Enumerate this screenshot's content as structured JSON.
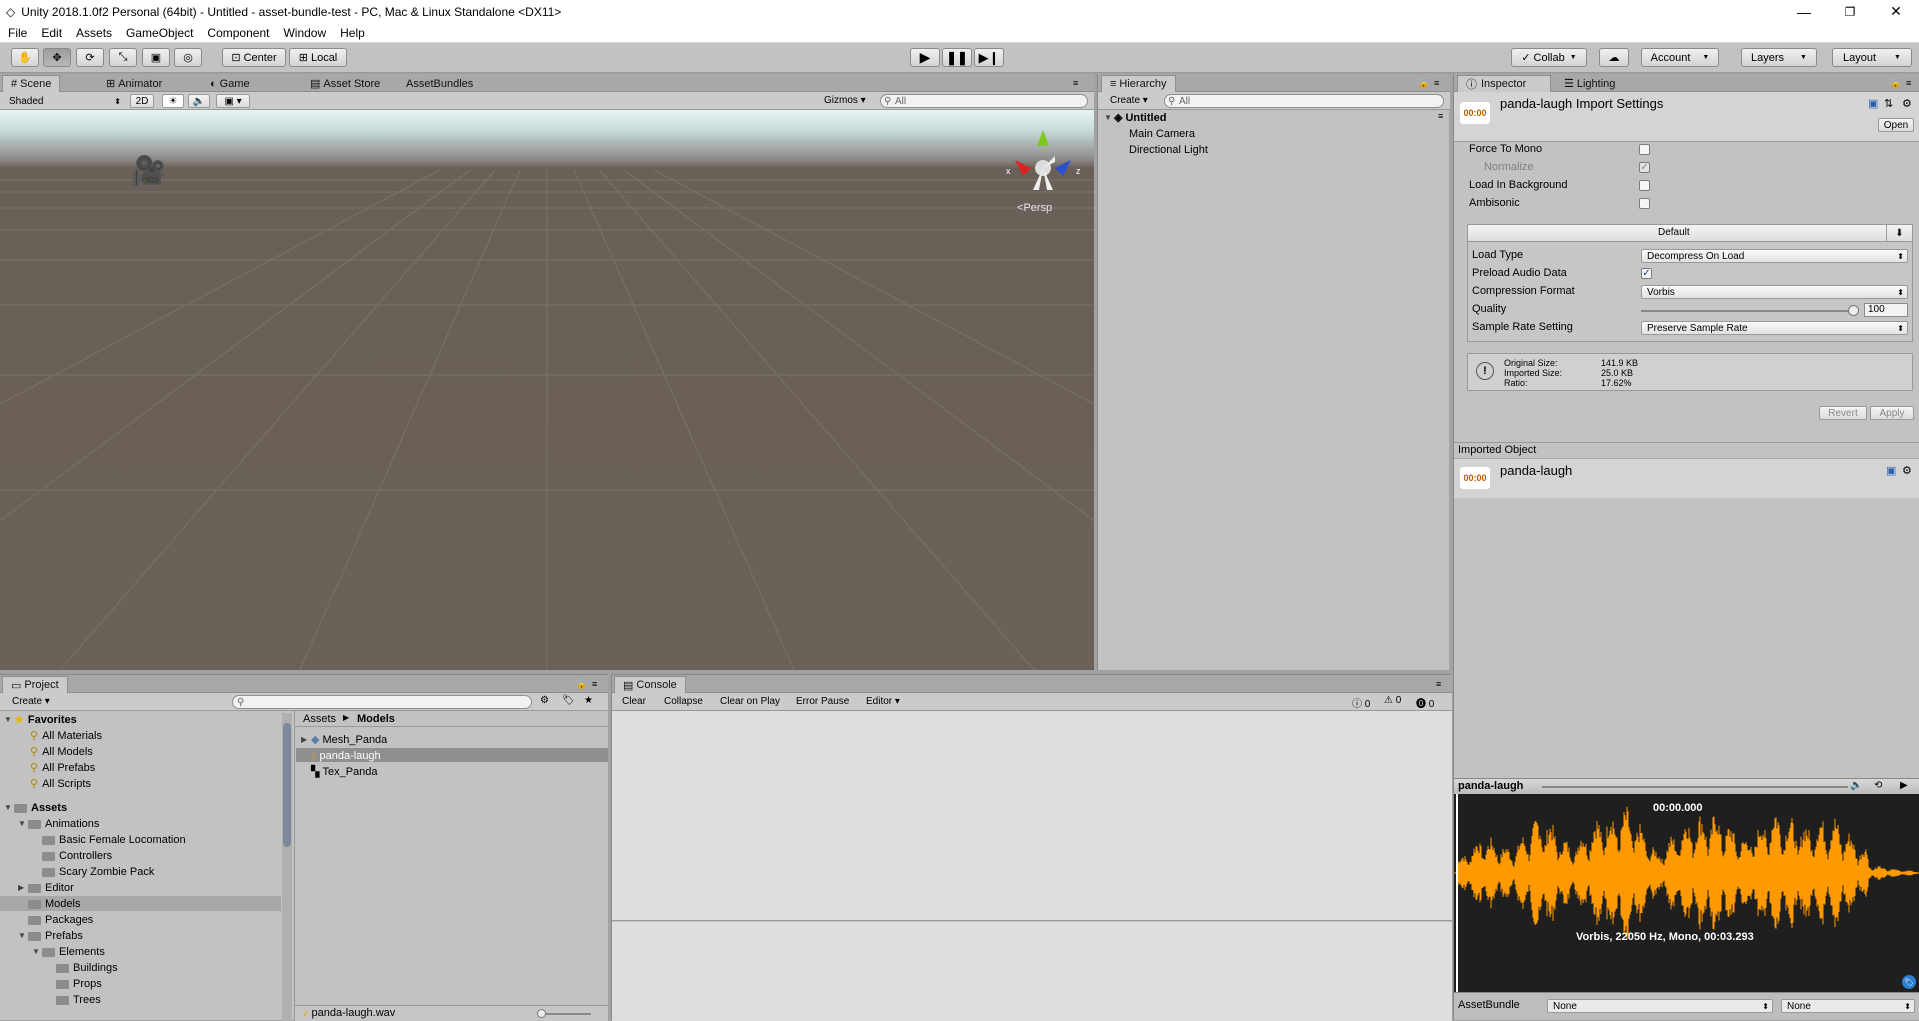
{
  "window": {
    "title": "Unity 2018.1.0f2 Personal (64bit) - Untitled - asset-bundle-test - PC, Mac & Linux Standalone <DX11>"
  },
  "menu": [
    "File",
    "Edit",
    "Assets",
    "GameObject",
    "Component",
    "Window",
    "Help"
  ],
  "toolbar": {
    "center": "Center",
    "local": "Local",
    "collab": "Collab",
    "account": "Account",
    "layers": "Layers",
    "layout": "Layout"
  },
  "scene": {
    "tabs": [
      "Scene",
      "Animator",
      "Game",
      "Asset Store",
      "AssetBundles"
    ],
    "shading": "Shaded",
    "mode2d": "2D",
    "gizmos": "Gizmos",
    "search_placeholder": "All",
    "persp": "Persp",
    "axis_x": "x",
    "axis_z": "z"
  },
  "hierarchy": {
    "tab": "Hierarchy",
    "create": "Create",
    "search_placeholder": "All",
    "scene_name": "Untitled",
    "items": [
      "Main Camera",
      "Directional Light"
    ]
  },
  "inspector": {
    "tabs": [
      "Inspector",
      "Lighting"
    ],
    "asset_title": "panda-laugh Import Settings",
    "icon_text": "00:00",
    "open": "Open",
    "force_to_mono": "Force To Mono",
    "normalize": "Normalize",
    "load_in_background": "Load In Background",
    "ambisonic": "Ambisonic",
    "platform_default": "Default",
    "load_type_label": "Load Type",
    "load_type_value": "Decompress On Load",
    "preload_label": "Preload Audio Data",
    "compression_label": "Compression Format",
    "compression_value": "Vorbis",
    "quality_label": "Quality",
    "quality_value": "100",
    "sample_rate_label": "Sample Rate Setting",
    "sample_rate_value": "Preserve Sample Rate",
    "original_size_label": "Original Size:",
    "original_size_value": "141.9 KB",
    "imported_size_label": "Imported Size:",
    "imported_size_value": "25.0 KB",
    "ratio_label": "Ratio:",
    "ratio_value": "17.62%",
    "revert": "Revert",
    "apply": "Apply",
    "imported_object": "Imported Object",
    "object_name": "panda-laugh",
    "preview_title": "panda-laugh",
    "preview_time": "00:00.000",
    "preview_info": "Vorbis, 22050 Hz, Mono, 00:03.293",
    "assetbundle_label": "AssetBundle",
    "assetbundle_value": "None",
    "variant_value": "None",
    "waveform_color": "#ff9900"
  },
  "project": {
    "tab": "Project",
    "create": "Create",
    "favorites": "Favorites",
    "fav_items": [
      "All Materials",
      "All Models",
      "All Prefabs",
      "All Scripts"
    ],
    "assets": "Assets",
    "tree": [
      {
        "label": "Animations",
        "depth": 1,
        "arrow": "▼"
      },
      {
        "label": "Basic Female Locomation",
        "depth": 2,
        "arrow": ""
      },
      {
        "label": "Controllers",
        "depth": 2,
        "arrow": ""
      },
      {
        "label": "Scary Zombie Pack",
        "depth": 2,
        "arrow": ""
      },
      {
        "label": "Editor",
        "depth": 1,
        "arrow": "▶"
      },
      {
        "label": "Models",
        "depth": 1,
        "arrow": ""
      },
      {
        "label": "Packages",
        "depth": 1,
        "arrow": ""
      },
      {
        "label": "Prefabs",
        "depth": 1,
        "arrow": "▼"
      },
      {
        "label": "Elements",
        "depth": 2,
        "arrow": "▼"
      },
      {
        "label": "Buildings",
        "depth": 3,
        "arrow": ""
      },
      {
        "label": "Props",
        "depth": 3,
        "arrow": ""
      },
      {
        "label": "Trees",
        "depth": 3,
        "arrow": ""
      }
    ],
    "breadcrumb": [
      "Assets",
      "Models"
    ],
    "files": [
      "Mesh_Panda",
      "panda-laugh",
      "Tex_Panda"
    ],
    "footer_file": "panda-laugh.wav"
  },
  "console": {
    "tab": "Console",
    "buttons": [
      "Clear",
      "Collapse",
      "Clear on Play",
      "Error Pause",
      "Editor"
    ],
    "counts": [
      "0",
      "0",
      "0"
    ]
  }
}
